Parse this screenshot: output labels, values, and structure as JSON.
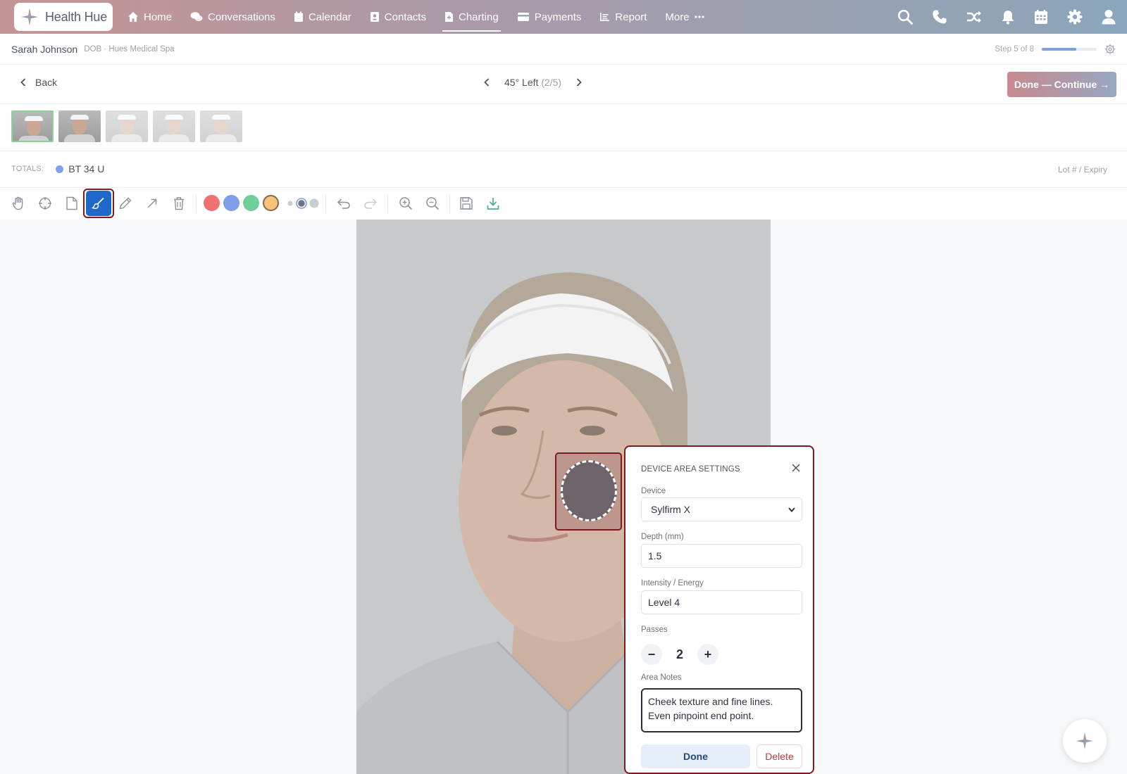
{
  "app": {
    "brand": "Health Hue",
    "nav": [
      {
        "label": "Home",
        "icon": "home-icon"
      },
      {
        "label": "Conversations",
        "icon": "chat-icon"
      },
      {
        "label": "Calendar",
        "icon": "calendar-icon"
      },
      {
        "label": "Contacts",
        "icon": "contact-icon"
      },
      {
        "label": "Charting",
        "icon": "chart-file-icon",
        "active": true
      },
      {
        "label": "Payments",
        "icon": "credit-card-icon"
      },
      {
        "label": "Report",
        "icon": "report-icon"
      },
      {
        "label": "More",
        "icon": "more-icon"
      }
    ],
    "right_icons": [
      "search-icon",
      "phone-icon",
      "shuffle-icon",
      "bell-icon",
      "calendar-grid-icon",
      "gear-icon",
      "user-icon"
    ]
  },
  "patient": {
    "name": "Sarah Johnson",
    "meta": "DOB · Hues Medical Spa",
    "step_text": "Step 5 of 8",
    "step_progress": 0.625
  },
  "view": {
    "back_label": "Back",
    "title": "45° Left",
    "position": "(2/5)",
    "done_continue_label": "Done — Continue →"
  },
  "thumbnails": {
    "count": 5,
    "selected": 1
  },
  "totals": {
    "label": "TOTALS:",
    "value": "BT 34 U",
    "dot_color": "#7f9fe8",
    "lot_label": "Lot # / Expiry"
  },
  "toolbar": {
    "tools": [
      "hand-icon",
      "crosshair-icon",
      "note-icon",
      "brush-icon",
      "pencil-icon",
      "arrow-icon",
      "trash-icon"
    ],
    "active_tool": "brush-icon",
    "colors": [
      "#f07171",
      "#7f9fe8",
      "#6ecf9a",
      "#f7c27a"
    ],
    "selected_color": "#f7c27a",
    "history": [
      "undo-icon",
      "redo-icon"
    ],
    "zoom": [
      "zoom-in-icon",
      "zoom-out-icon"
    ],
    "file": [
      "save-icon",
      "download-icon"
    ]
  },
  "panel": {
    "title": "DEVICE AREA SETTINGS",
    "device_label": "Device",
    "device_value": "Sylfirm X",
    "depth_label": "Depth (mm)",
    "depth_value": "1.5",
    "intensity_label": "Intensity / Energy",
    "intensity_value": "Level 4",
    "passes_label": "Passes",
    "passes_value": "2",
    "minus": "−",
    "plus": "+",
    "notes_label": "Area Notes",
    "notes_value": "Cheek texture and fine lines. Even pinpoint end point.",
    "done_label": "Done",
    "delete_label": "Delete"
  }
}
